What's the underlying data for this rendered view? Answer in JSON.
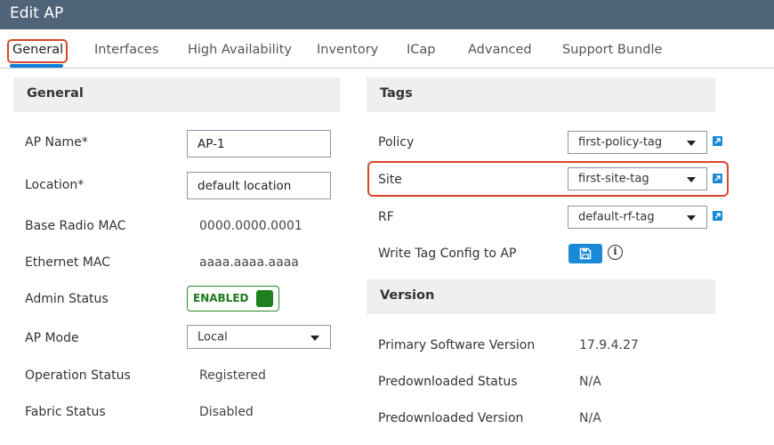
{
  "window": {
    "title": "Edit AP"
  },
  "tabs": [
    {
      "label": "General",
      "active": true
    },
    {
      "label": "Interfaces"
    },
    {
      "label": "High Availability"
    },
    {
      "label": "Inventory"
    },
    {
      "label": "ICap"
    },
    {
      "label": "Advanced"
    },
    {
      "label": "Support Bundle"
    }
  ],
  "general": {
    "header": "General",
    "ap_name": {
      "label": "AP Name*",
      "value": "AP-1"
    },
    "location": {
      "label": "Location*",
      "value": "default location"
    },
    "base_radio_mac": {
      "label": "Base Radio MAC",
      "value": "0000.0000.0001"
    },
    "ethernet_mac": {
      "label": "Ethernet MAC",
      "value": "aaaa.aaaa.aaaa"
    },
    "admin_status": {
      "label": "Admin Status",
      "value": "ENABLED"
    },
    "ap_mode": {
      "label": "AP Mode",
      "value": "Local"
    },
    "operation_status": {
      "label": "Operation Status",
      "value": "Registered"
    },
    "fabric_status": {
      "label": "Fabric Status",
      "value": "Disabled"
    }
  },
  "tags": {
    "header": "Tags",
    "policy": {
      "label": "Policy",
      "value": "first-policy-tag"
    },
    "site": {
      "label": "Site",
      "value": "first-site-tag"
    },
    "rf": {
      "label": "RF",
      "value": "default-rf-tag"
    },
    "write_tag": {
      "label": "Write Tag Config to AP"
    },
    "info_glyph": "i"
  },
  "version": {
    "header": "Version",
    "primary_software": {
      "label": "Primary Software Version",
      "value": "17.9.4.27"
    },
    "predownloaded_status": {
      "label": "Predownloaded Status",
      "value": "N/A"
    },
    "predownloaded_version": {
      "label": "Predownloaded Version",
      "value": "N/A"
    }
  },
  "colors": {
    "titlebar": "#4f6479",
    "accent": "#1a8ad8",
    "highlight": "#d9472a",
    "enabled_green": "#1f7f1f"
  },
  "icons": [
    "external-link-icon",
    "save-icon",
    "info-icon",
    "chevron-down-icon"
  ]
}
